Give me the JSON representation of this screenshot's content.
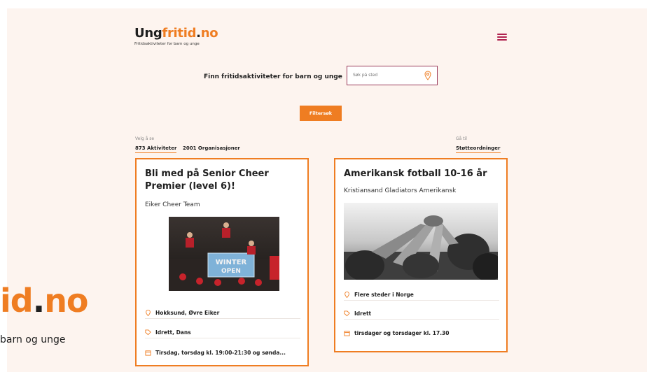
{
  "header": {
    "logo": {
      "part1": "Ung",
      "part2": "fritid",
      "dot": ".",
      "part3": "no"
    },
    "tagline": "Fritidsaktiviteter for barn og unge"
  },
  "search": {
    "label": "Finn fritidsaktiviteter for barn og unge",
    "placeholder": "Søk på sted",
    "filter_button": "Filtersøk"
  },
  "tabs": {
    "label": "Velg å se",
    "items": [
      {
        "label": "873 Aktiviteter",
        "active": true
      },
      {
        "label": "2001 Organisasjoner",
        "active": false
      }
    ]
  },
  "goto": {
    "label": "Gå til",
    "link": "Støtteordninger"
  },
  "cards": [
    {
      "title_line1": "Bli med på Senior Cheer",
      "title_line2": "Premier (level 6)!",
      "org": "Eiker Cheer Team",
      "image_text1": "WINTER",
      "image_text2": "OPEN",
      "location": "Hokksund, Øvre Eiker",
      "category": "Idrett, Dans",
      "time": "Tirsdag, torsdag kl. 19:00-21:30 og sønda..."
    },
    {
      "title_line1": "Amerikansk fotball 10-16 år",
      "title_line2": "",
      "org": "Kristiansand Gladiators Amerikansk",
      "location": "Flere steder i Norge",
      "category": "Idrett",
      "time": "tirsdager og torsdager kl. 17.30"
    }
  ],
  "footer": {
    "logo_part1": "id",
    "logo_dot": ".",
    "logo_part2": "no",
    "tagline": "barn og unge"
  },
  "colors": {
    "accent": "#ef7d22",
    "page_background": "#fdf4ef",
    "menu_icon": "#b0224f",
    "search_border": "#9a3a5a"
  }
}
